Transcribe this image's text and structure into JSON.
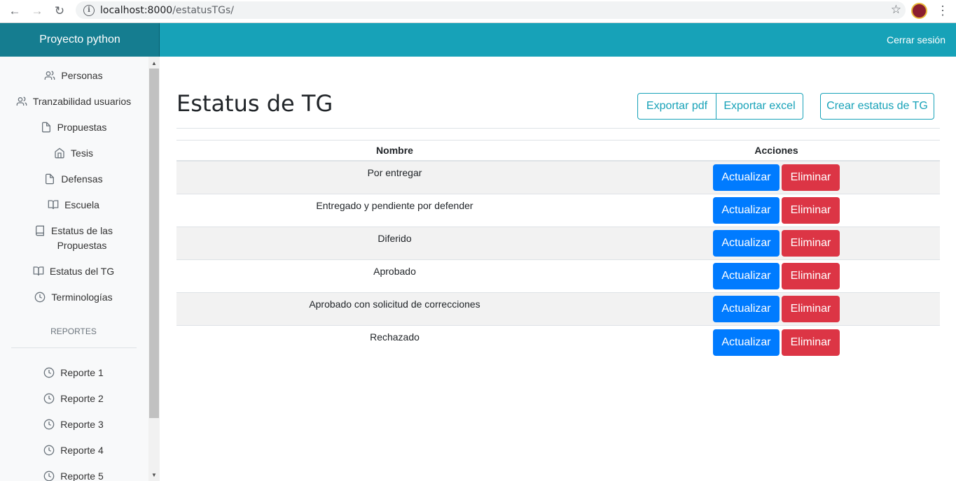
{
  "browser": {
    "url_host": "localhost:8000",
    "url_path": "/estatusTGs/"
  },
  "navbar": {
    "brand": "Proyecto python",
    "logout": "Cerrar sesión",
    "color": "#17a2b8"
  },
  "sidebar": {
    "items": [
      {
        "label": "Personas",
        "icon": "users-icon"
      },
      {
        "label": "Tranzabilidad usuarios",
        "icon": "users-icon"
      },
      {
        "label": "Propuestas",
        "icon": "file-icon"
      },
      {
        "label": "Tesis",
        "icon": "home-icon"
      },
      {
        "label": "Defensas",
        "icon": "file-icon"
      },
      {
        "label": "Escuela",
        "icon": "book-open-icon"
      },
      {
        "label_line1": "Estatus de las",
        "label_line2": "Propuestas",
        "icon": "book-icon"
      },
      {
        "label": "Estatus del TG",
        "icon": "book-open-icon"
      },
      {
        "label": "Terminologías",
        "icon": "clock-icon"
      }
    ],
    "reports_heading": "REPORTES",
    "reports": [
      {
        "label": "Reporte 1",
        "icon": "clock-icon"
      },
      {
        "label": "Reporte 2",
        "icon": "clock-icon"
      },
      {
        "label": "Reporte 3",
        "icon": "clock-icon"
      },
      {
        "label": "Reporte 4",
        "icon": "clock-icon"
      },
      {
        "label": "Reporte 5",
        "icon": "clock-icon"
      }
    ]
  },
  "main": {
    "title": "Estatus de TG",
    "buttons": {
      "export_pdf": "Exportar pdf",
      "export_excel": "Exportar excel",
      "create": "Crear estatus de TG"
    },
    "table": {
      "headers": [
        "Nombre",
        "Acciones"
      ],
      "rows": [
        {
          "name": "Por entregar"
        },
        {
          "name": "Entregado y pendiente por defender"
        },
        {
          "name": "Diferido"
        },
        {
          "name": "Aprobado"
        },
        {
          "name": "Aprobado con solicitud de correcciones"
        },
        {
          "name": "Rechazado"
        }
      ],
      "update_label": "Actualizar",
      "delete_label": "Eliminar"
    }
  },
  "colors": {
    "primary": "#007bff",
    "danger": "#dc3545",
    "info": "#17a2b8"
  }
}
